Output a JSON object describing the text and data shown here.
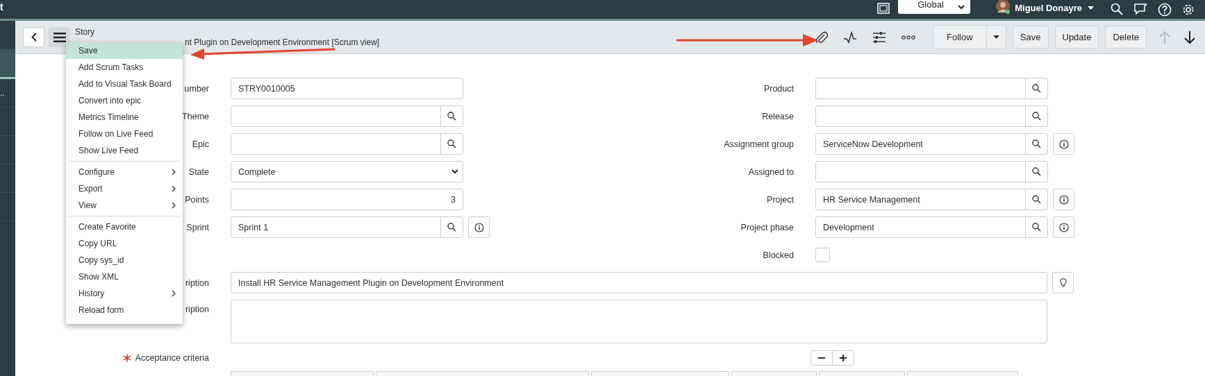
{
  "top_bar": {
    "title": "t",
    "scope": "Global",
    "user": "Miguel Donayre"
  },
  "sidebar": {
    "items": [
      {
        "selected": false
      },
      {
        "selected": true
      },
      {
        "label": "..",
        "selected": false
      },
      {
        "selected": false
      },
      {
        "selected": false
      },
      {
        "selected": false
      },
      {
        "selected": false
      }
    ]
  },
  "form_header": {
    "title": "Story",
    "subtitle": "nt Plugin on Development Environment [Scrum view]",
    "follow": "Follow",
    "buttons": [
      "Save",
      "Update",
      "Delete"
    ],
    "nav": [
      {
        "kind": "up",
        "disabled": true
      },
      {
        "kind": "down",
        "disabled": false
      }
    ]
  },
  "context_menu": {
    "groups": [
      [
        {
          "label": "Save",
          "selected": true,
          "submenu": false
        },
        {
          "label": "Add Scrum Tasks",
          "selected": false,
          "submenu": false
        },
        {
          "label": "Add to Visual Task Board",
          "selected": false,
          "submenu": false
        },
        {
          "label": "Convert into epic",
          "selected": false,
          "submenu": false
        },
        {
          "label": "Metrics Timeline",
          "selected": false,
          "submenu": false
        },
        {
          "label": "Follow on Live Feed",
          "selected": false,
          "submenu": false
        },
        {
          "label": "Show Live Feed",
          "selected": false,
          "submenu": false
        }
      ],
      [
        {
          "label": "Configure",
          "selected": false,
          "submenu": true
        },
        {
          "label": "Export",
          "selected": false,
          "submenu": true
        },
        {
          "label": "View",
          "selected": false,
          "submenu": true
        }
      ],
      [
        {
          "label": "Create Favorite",
          "selected": false,
          "submenu": false
        },
        {
          "label": "Copy URL",
          "selected": false,
          "submenu": false
        },
        {
          "label": "Copy sys_id",
          "selected": false,
          "submenu": false
        },
        {
          "label": "Show XML",
          "selected": false,
          "submenu": false
        },
        {
          "label": "History",
          "selected": false,
          "submenu": true
        },
        {
          "label": "Reload form",
          "selected": false,
          "submenu": false
        }
      ]
    ]
  },
  "form": {
    "left_fields": [
      {
        "label": "umber",
        "kind": "text",
        "value": "STRY0010005",
        "info": false
      },
      {
        "label": "Theme",
        "kind": "reference",
        "info": false
      },
      {
        "label": "Epic",
        "kind": "reference",
        "info": false
      },
      {
        "label": "State",
        "kind": "choice",
        "value": "Complete",
        "info": false
      },
      {
        "label": "Points",
        "kind": "number",
        "value": "3",
        "info": false
      },
      {
        "label": "Sprint",
        "kind": "reference",
        "value": "Sprint 1",
        "info": true
      }
    ],
    "right_fields": [
      {
        "label": "Product",
        "kind": "reference",
        "info": false
      },
      {
        "label": "Release",
        "kind": "reference",
        "info": false
      },
      {
        "label": "Assignment group",
        "kind": "reference",
        "value": "ServiceNow Development",
        "info": true
      },
      {
        "label": "Assigned to",
        "kind": "reference",
        "info": false
      },
      {
        "label": "Project",
        "kind": "reference",
        "value": "HR Service Management",
        "info": true
      },
      {
        "label": "Project phase",
        "kind": "reference",
        "value": "Development",
        "info": true
      },
      {
        "label": "Blocked",
        "kind": "checkbox",
        "checked": false,
        "info": false
      }
    ],
    "short_description": {
      "label": "ription",
      "value": "Install HR Service Management Plugin on Development Environment",
      "suggest": true
    },
    "description": {
      "label": "ription"
    },
    "acceptance_criteria": {
      "label": "Acceptance criteria",
      "mandatory": true
    }
  }
}
